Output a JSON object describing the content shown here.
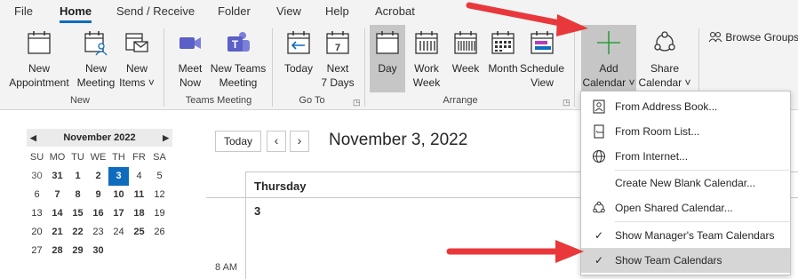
{
  "tabs": [
    {
      "label": "File"
    },
    {
      "label": "Home"
    },
    {
      "label": "Send / Receive"
    },
    {
      "label": "Folder"
    },
    {
      "label": "View"
    },
    {
      "label": "Help"
    },
    {
      "label": "Acrobat"
    }
  ],
  "ribbon": {
    "new_appointment": "New\nAppointment",
    "new_meeting": "New\nMeeting",
    "new_items": "New\nItems ˅",
    "group_new": "New",
    "meet_now": "Meet\nNow",
    "new_teams_meeting": "New Teams\nMeeting",
    "group_teams": "Teams Meeting",
    "today": "Today",
    "next_7_days": "Next\n7 Days",
    "group_goto": "Go To",
    "day": "Day",
    "work_week": "Work\nWeek",
    "week": "Week",
    "month": "Month",
    "schedule_view": "Schedule\nView",
    "group_arrange": "Arrange",
    "add_calendar": "Add\nCalendar ˅",
    "share_calendar": "Share\nCalendar ˅",
    "browse_groups": "Browse Groups",
    "next_7_days_num": "7"
  },
  "minical": {
    "title": "November 2022",
    "weekdays": [
      "SU",
      "MO",
      "TU",
      "WE",
      "TH",
      "FR",
      "SA"
    ],
    "days": [
      {
        "d": "30",
        "k": "other"
      },
      {
        "d": "31",
        "k": "bold"
      },
      {
        "d": "1",
        "k": "bold"
      },
      {
        "d": "2",
        "k": "bold"
      },
      {
        "d": "3",
        "k": "today"
      },
      {
        "d": "4",
        "k": "normal"
      },
      {
        "d": "5",
        "k": "normal"
      },
      {
        "d": "6",
        "k": "normal"
      },
      {
        "d": "7",
        "k": "bold"
      },
      {
        "d": "8",
        "k": "bold"
      },
      {
        "d": "9",
        "k": "bold"
      },
      {
        "d": "10",
        "k": "bold"
      },
      {
        "d": "11",
        "k": "bold"
      },
      {
        "d": "12",
        "k": "normal"
      },
      {
        "d": "13",
        "k": "normal"
      },
      {
        "d": "14",
        "k": "bold"
      },
      {
        "d": "15",
        "k": "bold"
      },
      {
        "d": "16",
        "k": "bold"
      },
      {
        "d": "17",
        "k": "bold"
      },
      {
        "d": "18",
        "k": "bold"
      },
      {
        "d": "19",
        "k": "normal"
      },
      {
        "d": "20",
        "k": "normal"
      },
      {
        "d": "21",
        "k": "bold"
      },
      {
        "d": "22",
        "k": "bold"
      },
      {
        "d": "23",
        "k": "normal"
      },
      {
        "d": "24",
        "k": "normal"
      },
      {
        "d": "25",
        "k": "bold"
      },
      {
        "d": "26",
        "k": "normal"
      },
      {
        "d": "27",
        "k": "normal"
      },
      {
        "d": "28",
        "k": "bold"
      },
      {
        "d": "29",
        "k": "bold"
      },
      {
        "d": "30",
        "k": "bold"
      },
      {
        "d": "",
        "k": "normal"
      },
      {
        "d": "",
        "k": "normal"
      },
      {
        "d": "",
        "k": "normal"
      }
    ]
  },
  "main": {
    "today_button": "Today",
    "prev": "‹",
    "next": "›",
    "date_title": "November 3, 2022",
    "day_name": "Thursday",
    "day_number": "3",
    "time_label": "8 AM"
  },
  "dropdown": {
    "from_address_book": "From Address Book...",
    "from_room_list": "From Room List...",
    "from_internet": "From Internet...",
    "create_new_blank": "Create New Blank Calendar...",
    "open_shared": "Open Shared Calendar...",
    "show_manager_team": "Show Manager's Team Calendars",
    "show_team": "Show Team Calendars"
  },
  "colors": {
    "accent": "#0f6cbd",
    "arrow": "#e8383b",
    "teams_purple": "#5b5fc7",
    "green": "#2e9e3e"
  }
}
